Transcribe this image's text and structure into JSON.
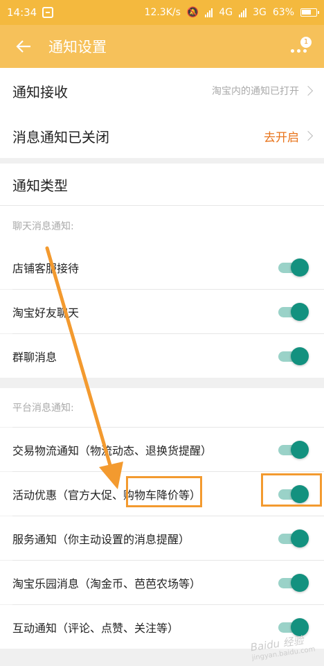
{
  "status_bar": {
    "time": "14:34",
    "network_speed": "12.3K/s",
    "network_1": "4G",
    "network_2": "3G",
    "battery": "63%"
  },
  "app_bar": {
    "title": "通知设置",
    "badge_count": "1"
  },
  "settings": {
    "receive": {
      "label": "通知接收",
      "value": "淘宝内的通知已打开"
    },
    "closed": {
      "label": "消息通知已关闭",
      "action": "去开启"
    },
    "types_title": "通知类型"
  },
  "chat_section": {
    "header": "聊天消息通知:",
    "items": [
      {
        "label": "店铺客服接待",
        "enabled": true
      },
      {
        "label": "淘宝好友聊天",
        "enabled": true
      },
      {
        "label": "群聊消息",
        "enabled": true
      }
    ]
  },
  "platform_section": {
    "header": "平台消息通知:",
    "items": [
      {
        "label": "交易物流通知（物流动态、退换货提醒）",
        "enabled": true
      },
      {
        "label": "活动优惠（官方大促、购物车降价等）",
        "enabled": true
      },
      {
        "label": "服务通知（你主动设置的消息提醒）",
        "enabled": true
      },
      {
        "label": "淘宝乐园消息（淘金币、芭芭农场等）",
        "enabled": true
      },
      {
        "label": "互动通知（评论、点赞、关注等）",
        "enabled": true
      }
    ]
  },
  "colors": {
    "status_bar": "#f4b93e",
    "app_bar": "#f6c15a",
    "toggle_on": "#13917f",
    "annotation": "#f39a2f"
  },
  "watermark": {
    "brand": "Baidu 经验",
    "domain": "jingyan.baidu.com"
  }
}
